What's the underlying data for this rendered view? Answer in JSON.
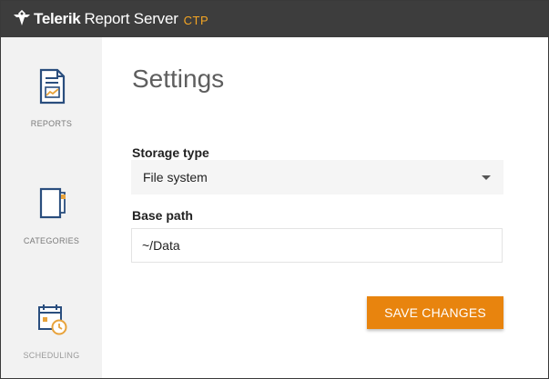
{
  "brand": {
    "name": "Telerik",
    "product": "Report Server",
    "edition": "CTP",
    "logo_icon": "telerik-logo-icon",
    "edition_color": "#f5a623"
  },
  "sidebar": {
    "items": [
      {
        "label": "REPORTS",
        "icon": "report-document-icon"
      },
      {
        "label": "CATEGORIES",
        "icon": "category-folder-icon"
      },
      {
        "label": "SCHEDULING",
        "icon": "calendar-clock-icon"
      }
    ],
    "icon_color": "#2a4e7e",
    "accent_color": "#e8a33c"
  },
  "main": {
    "title": "Settings",
    "storage_type": {
      "label": "Storage type",
      "selected": "File system",
      "caret_icon": "caret-down-icon"
    },
    "base_path": {
      "label": "Base path",
      "value": "~/Data"
    },
    "save_label": "SAVE CHANGES",
    "save_color": "#e8840e"
  }
}
